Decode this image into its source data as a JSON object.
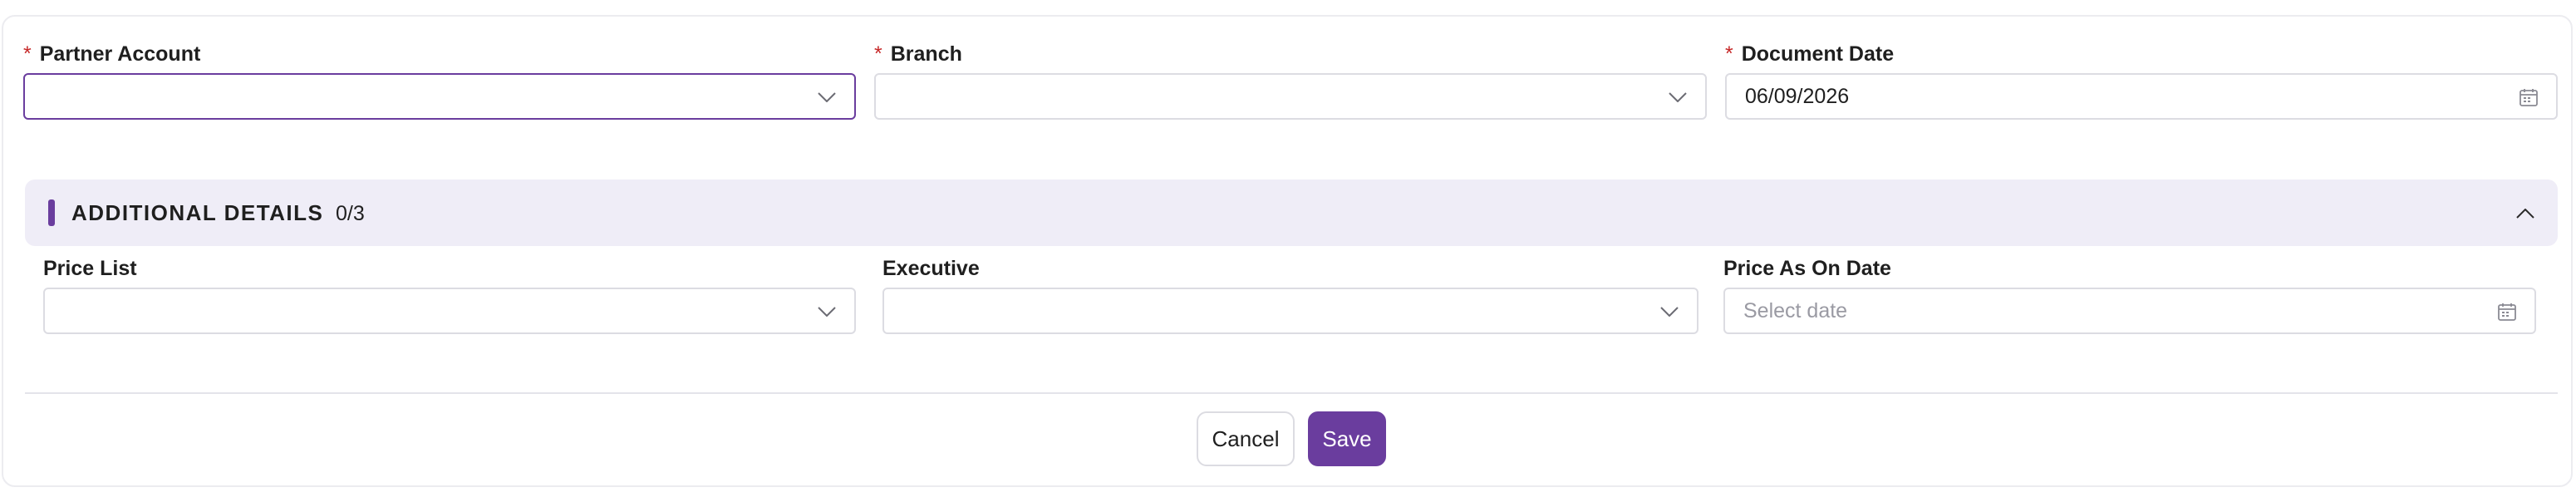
{
  "form": {
    "partner_account": {
      "label": "Partner Account",
      "required_mark": "*",
      "value": ""
    },
    "branch": {
      "label": "Branch",
      "required_mark": "*",
      "value": ""
    },
    "document_date": {
      "label": "Document Date",
      "required_mark": "*",
      "value": "06/09/2026"
    }
  },
  "additional_details": {
    "title": "ADDITIONAL DETAILS",
    "count": "0/3",
    "expanded": true,
    "price_list": {
      "label": "Price List",
      "value": ""
    },
    "executive": {
      "label": "Executive",
      "value": ""
    },
    "price_as_on_date": {
      "label": "Price As On Date",
      "placeholder": "Select date",
      "value": ""
    }
  },
  "actions": {
    "cancel_label": "Cancel",
    "save_label": "Save"
  },
  "icons": {
    "dropdown": "chevron-down-icon",
    "date": "calendar-icon",
    "collapse": "chevron-up-icon"
  },
  "colors": {
    "accent": "#6a3d9e",
    "section_bg": "#efedf7",
    "required": "#c62828",
    "border": "#dcdce2"
  }
}
